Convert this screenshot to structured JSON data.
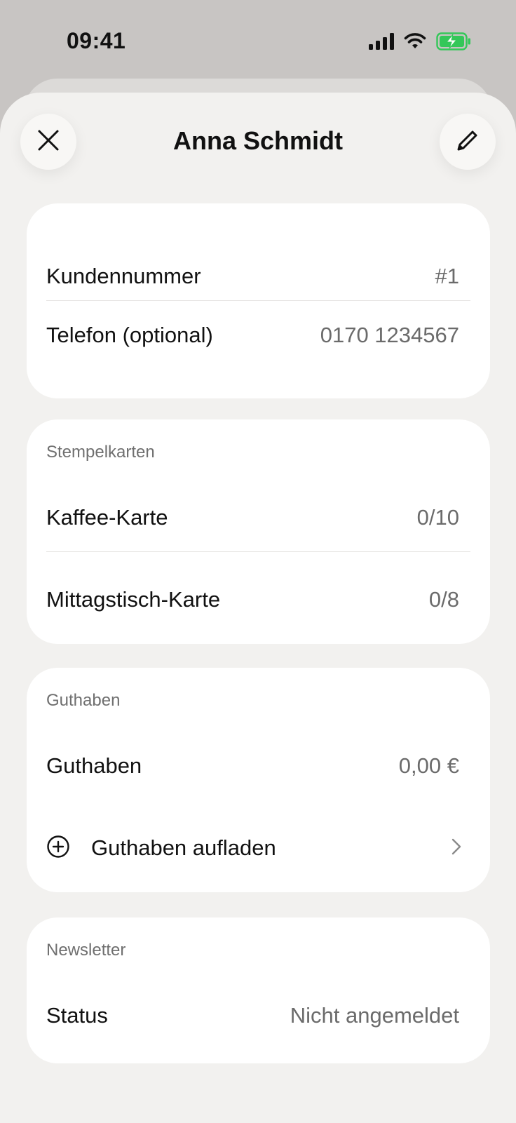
{
  "status_bar": {
    "time": "09:41",
    "icons": [
      "signal-icon",
      "wifi-icon",
      "battery-charging-icon"
    ],
    "battery_color": "#34c759"
  },
  "header": {
    "title": "Anna Schmidt",
    "close_icon": "close-icon",
    "edit_icon": "pencil-icon"
  },
  "customer": {
    "rows": [
      {
        "label": "Kundennummer",
        "value": "#1"
      },
      {
        "label": "Telefon (optional)",
        "value": "0170 1234567"
      }
    ]
  },
  "stamp_cards": {
    "title": "Stempelkarten",
    "rows": [
      {
        "label": "Kaffee-Karte",
        "value": "0/10"
      },
      {
        "label": "Mittagstisch-Karte",
        "value": "0/8"
      }
    ]
  },
  "credit": {
    "title": "Guthaben",
    "balance_label": "Guthaben",
    "balance_value": "0,00 €",
    "topup_label": "Guthaben aufladen",
    "topup_icon": "plus-circle-icon",
    "chevron_icon": "chevron-right-icon"
  },
  "newsletter": {
    "title": "Newsletter",
    "status_label": "Status",
    "status_value": "Nicht angemeldet"
  },
  "colors": {
    "background": "#c8c5c3",
    "sheet": "#f2f1ef",
    "card": "#ffffff",
    "text_primary": "#111111",
    "text_secondary": "#6b6b6b"
  }
}
